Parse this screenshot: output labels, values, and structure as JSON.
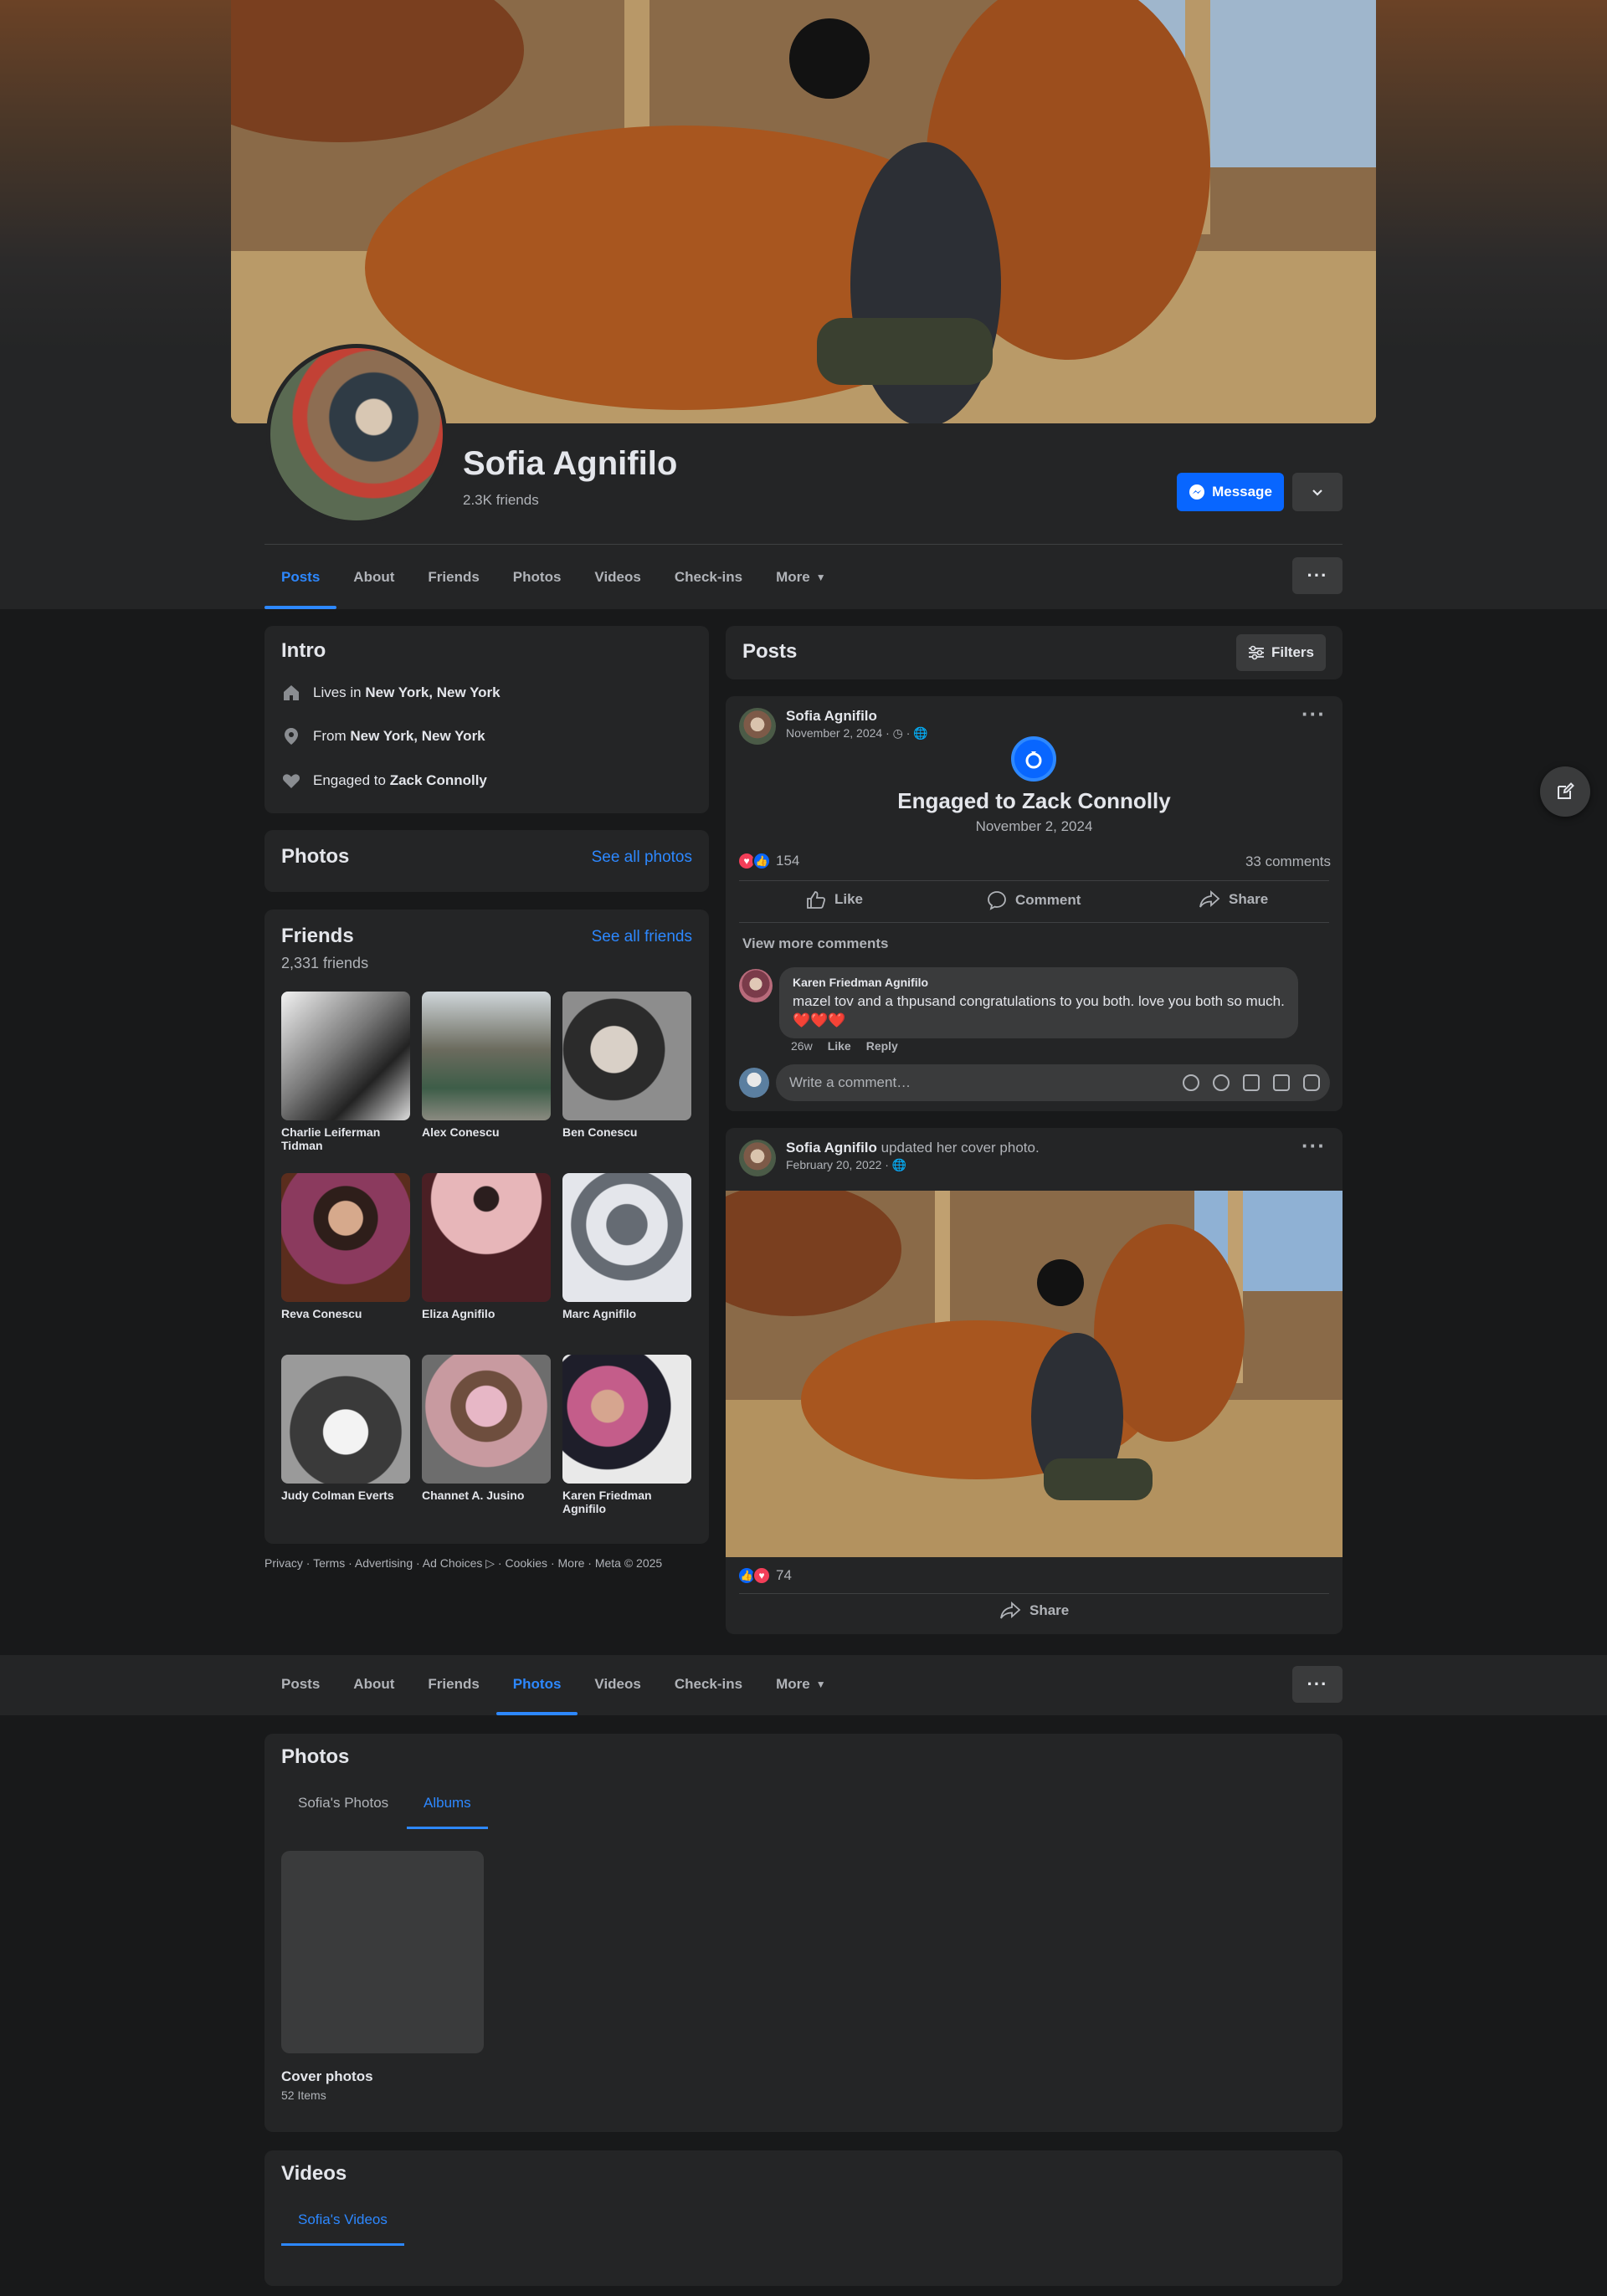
{
  "profile": {
    "name": "Sofia Agnifilo",
    "friends_summary": "2.3K friends",
    "message_label": "Message"
  },
  "tabs": [
    "Posts",
    "About",
    "Friends",
    "Photos",
    "Videos",
    "Check-ins",
    "More"
  ],
  "intro": {
    "title": "Intro",
    "lives_prefix": "Lives in ",
    "lives_place": "New York, New York",
    "from_prefix": "From ",
    "from_place": "New York, New York",
    "engaged_prefix": "Engaged to ",
    "engaged_name": "Zack Connolly"
  },
  "photos_card": {
    "title": "Photos",
    "link": "See all photos"
  },
  "friends_card": {
    "title": "Friends",
    "link": "See all friends",
    "count": "2,331 friends",
    "items": [
      {
        "name": "Charlie Leiferman Tidman"
      },
      {
        "name": "Alex Conescu"
      },
      {
        "name": "Ben Conescu"
      },
      {
        "name": "Reva Conescu"
      },
      {
        "name": "Eliza Agnifilo"
      },
      {
        "name": "Marc Agnifilo"
      },
      {
        "name": "Judy Colman Everts"
      },
      {
        "name": "Channet A. Jusino"
      },
      {
        "name": "Karen Friedman Agnifilo"
      }
    ]
  },
  "footer": "Privacy · Terms · Advertising · Ad Choices ▷ · Cookies · More · Meta © 2025",
  "posts_header": {
    "title": "Posts",
    "filters": "Filters"
  },
  "post1": {
    "author": "Sofia Agnifilo",
    "date": "November 2, 2024 ·",
    "event_title": "Engaged to Zack Connolly",
    "event_date": "November 2, 2024",
    "reactions": "154",
    "comments": "33 comments",
    "like": "Like",
    "comment": "Comment",
    "share": "Share",
    "view_more": "View more comments",
    "comment_author": "Karen Friedman Agnifilo",
    "comment_text": "mazel tov and a thpusand congratulations to you both. love you both so much. ❤️❤️❤️",
    "comment_age": "26w",
    "comment_like": "Like",
    "comment_reply": "Reply",
    "write_placeholder": "Write a comment…"
  },
  "post2": {
    "author": "Sofia Agnifilo",
    "action": " updated her cover photo.",
    "date": "February 20, 2022 ·",
    "reactions": "74",
    "share": "Share"
  },
  "photos_section": {
    "title": "Photos",
    "subtab_1": "Sofia's Photos",
    "subtab_2": "Albums",
    "album_name": "Cover photos",
    "album_count": "52 Items"
  },
  "videos_section": {
    "title": "Videos",
    "subtab_1": "Sofia's Videos"
  },
  "colors": {
    "accent": "#2d88ff",
    "button_blue": "#0866ff",
    "card": "#242526",
    "page": "#18191a"
  }
}
